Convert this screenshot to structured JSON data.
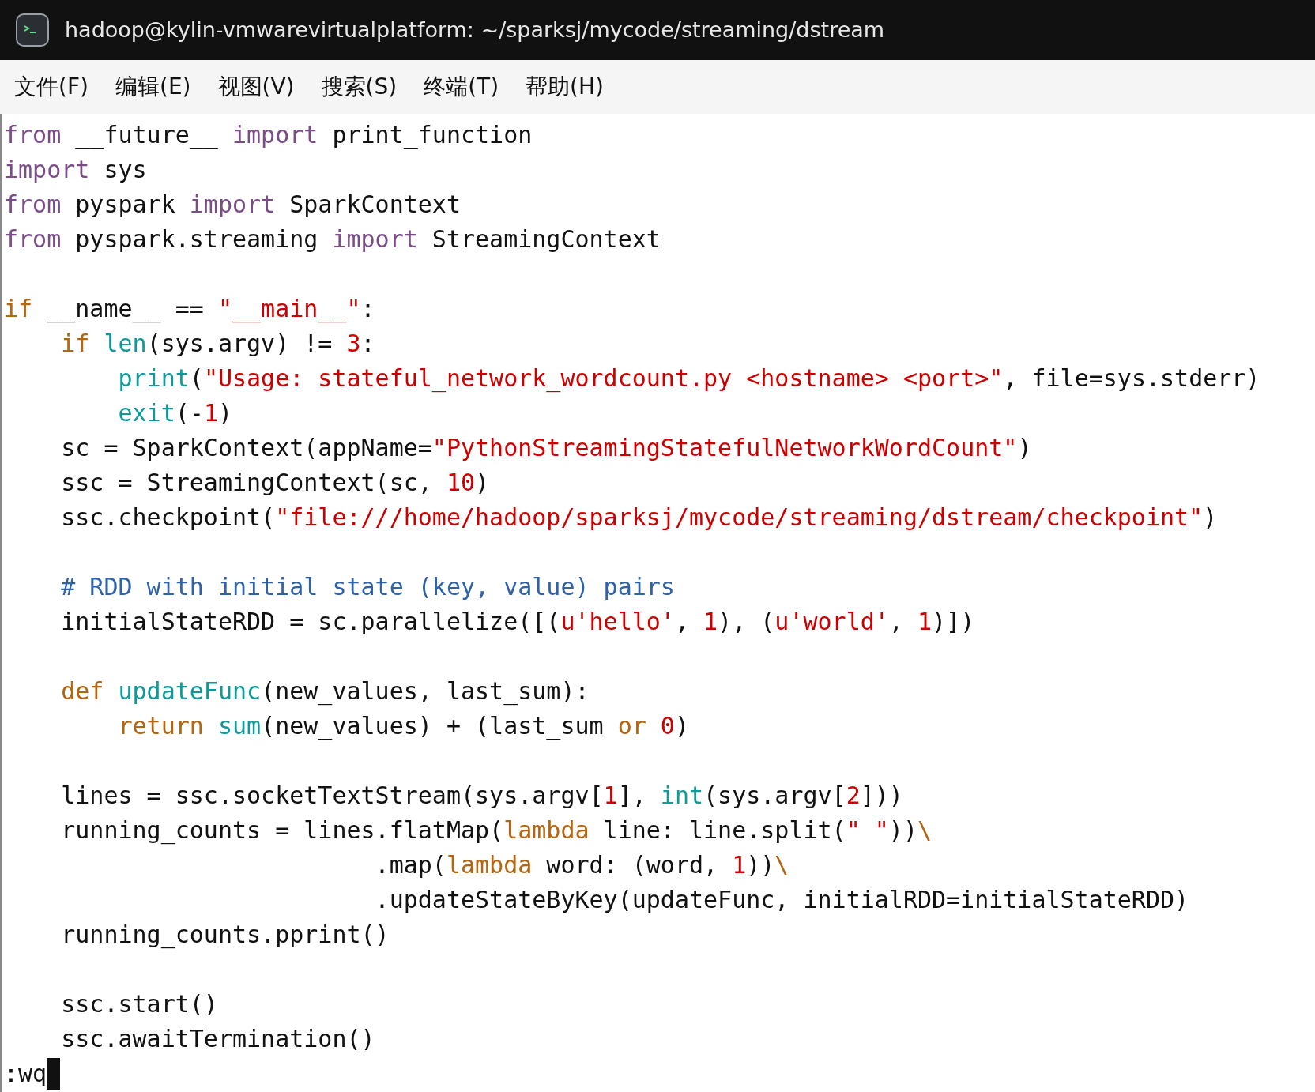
{
  "window": {
    "title": "hadoop@kylin-vmwarevirtualplatform: ~/sparksj/mycode/streaming/dstream"
  },
  "menu": [
    "文件(F)",
    "编辑(E)",
    "视图(V)",
    "搜索(S)",
    "终端(T)",
    "帮助(H)"
  ],
  "lines": [
    {
      "kind": "code",
      "tokens": [
        {
          "kind": "keyword",
          "text": "from"
        },
        {
          "kind": "plain",
          "text": " __future__ "
        },
        {
          "kind": "keyword",
          "text": "import"
        },
        {
          "kind": "plain",
          "text": " print_function"
        }
      ]
    },
    {
      "kind": "code",
      "tokens": [
        {
          "kind": "keyword",
          "text": "import"
        },
        {
          "kind": "plain",
          "text": " sys"
        }
      ]
    },
    {
      "kind": "code",
      "tokens": [
        {
          "kind": "keyword",
          "text": "from"
        },
        {
          "kind": "plain",
          "text": " pyspark "
        },
        {
          "kind": "keyword",
          "text": "import"
        },
        {
          "kind": "plain",
          "text": " SparkContext"
        }
      ]
    },
    {
      "kind": "code",
      "tokens": [
        {
          "kind": "keyword",
          "text": "from"
        },
        {
          "kind": "plain",
          "text": " pyspark.streaming "
        },
        {
          "kind": "keyword",
          "text": "import"
        },
        {
          "kind": "plain",
          "text": " StreamingContext"
        }
      ]
    },
    {
      "kind": "blank"
    },
    {
      "kind": "code",
      "tokens": [
        {
          "kind": "statement",
          "text": "if"
        },
        {
          "kind": "plain",
          "text": " __name__ == "
        },
        {
          "kind": "string",
          "text": "\"__main__\""
        },
        {
          "kind": "plain",
          "text": ":"
        }
      ]
    },
    {
      "kind": "code",
      "tokens": [
        {
          "kind": "statement",
          "text": "    if"
        },
        {
          "kind": "builtin",
          "text": " len"
        },
        {
          "kind": "plain",
          "text": "(sys.argv) != "
        },
        {
          "kind": "number",
          "text": "3"
        },
        {
          "kind": "plain",
          "text": ":"
        }
      ]
    },
    {
      "kind": "code",
      "tokens": [
        {
          "kind": "builtin",
          "text": "        print"
        },
        {
          "kind": "plain",
          "text": "("
        },
        {
          "kind": "string",
          "text": "\"Usage: stateful_network_wordcount.py <hostname> <port>\""
        },
        {
          "kind": "plain",
          "text": ", file=sys.stderr)"
        }
      ]
    },
    {
      "kind": "code",
      "tokens": [
        {
          "kind": "builtin",
          "text": "        exit"
        },
        {
          "kind": "plain",
          "text": "(-"
        },
        {
          "kind": "number",
          "text": "1"
        },
        {
          "kind": "plain",
          "text": ")"
        }
      ]
    },
    {
      "kind": "code",
      "tokens": [
        {
          "kind": "plain",
          "text": "    sc = SparkContext(appName="
        },
        {
          "kind": "string",
          "text": "\"PythonStreamingStatefulNetworkWordCount\""
        },
        {
          "kind": "plain",
          "text": ")"
        }
      ]
    },
    {
      "kind": "code",
      "tokens": [
        {
          "kind": "plain",
          "text": "    ssc = StreamingContext(sc, "
        },
        {
          "kind": "number",
          "text": "10"
        },
        {
          "kind": "plain",
          "text": ")"
        }
      ]
    },
    {
      "kind": "code",
      "tokens": [
        {
          "kind": "plain",
          "text": "    ssc.checkpoint("
        },
        {
          "kind": "string",
          "text": "\"file:///home/hadoop/sparksj/mycode/streaming/dstream/checkpoint\""
        },
        {
          "kind": "plain",
          "text": ")"
        }
      ]
    },
    {
      "kind": "blank"
    },
    {
      "kind": "code",
      "tokens": [
        {
          "kind": "comment",
          "text": "    # RDD with initial state (key, value) pairs"
        }
      ]
    },
    {
      "kind": "code",
      "tokens": [
        {
          "kind": "plain",
          "text": "    initialStateRDD = sc.parallelize([("
        },
        {
          "kind": "string",
          "text": "u'hello'"
        },
        {
          "kind": "plain",
          "text": ", "
        },
        {
          "kind": "number",
          "text": "1"
        },
        {
          "kind": "plain",
          "text": "), ("
        },
        {
          "kind": "string",
          "text": "u'world'"
        },
        {
          "kind": "plain",
          "text": ", "
        },
        {
          "kind": "number",
          "text": "1"
        },
        {
          "kind": "plain",
          "text": ")])"
        }
      ]
    },
    {
      "kind": "blank"
    },
    {
      "kind": "code",
      "tokens": [
        {
          "kind": "statement",
          "text": "    def"
        },
        {
          "kind": "builtin",
          "text": " updateFunc"
        },
        {
          "kind": "plain",
          "text": "(new_values, last_sum):"
        }
      ]
    },
    {
      "kind": "code",
      "tokens": [
        {
          "kind": "statement",
          "text": "        return"
        },
        {
          "kind": "builtin",
          "text": " sum"
        },
        {
          "kind": "plain",
          "text": "(new_values) + (last_sum "
        },
        {
          "kind": "statement",
          "text": "or"
        },
        {
          "kind": "number",
          "text": " 0"
        },
        {
          "kind": "plain",
          "text": ")"
        }
      ]
    },
    {
      "kind": "blank"
    },
    {
      "kind": "code",
      "tokens": [
        {
          "kind": "plain",
          "text": "    lines = ssc.socketTextStream(sys.argv["
        },
        {
          "kind": "number",
          "text": "1"
        },
        {
          "kind": "plain",
          "text": "], "
        },
        {
          "kind": "builtin",
          "text": "int"
        },
        {
          "kind": "plain",
          "text": "(sys.argv["
        },
        {
          "kind": "number",
          "text": "2"
        },
        {
          "kind": "plain",
          "text": "]))"
        }
      ]
    },
    {
      "kind": "code",
      "tokens": [
        {
          "kind": "plain",
          "text": "    running_counts = lines.flatMap("
        },
        {
          "kind": "statement",
          "text": "lambda"
        },
        {
          "kind": "plain",
          "text": " line: line.split("
        },
        {
          "kind": "string",
          "text": "\" \""
        },
        {
          "kind": "plain",
          "text": "))"
        },
        {
          "kind": "statement",
          "text": "\\"
        }
      ]
    },
    {
      "kind": "code",
      "tokens": [
        {
          "kind": "plain",
          "text": "                          .map("
        },
        {
          "kind": "statement",
          "text": "lambda"
        },
        {
          "kind": "plain",
          "text": " word: (word, "
        },
        {
          "kind": "number",
          "text": "1"
        },
        {
          "kind": "plain",
          "text": "))"
        },
        {
          "kind": "statement",
          "text": "\\"
        }
      ]
    },
    {
      "kind": "code",
      "tokens": [
        {
          "kind": "plain",
          "text": "                          .updateStateByKey(updateFunc, initialRDD=initialStateRDD)"
        }
      ]
    },
    {
      "kind": "code",
      "tokens": [
        {
          "kind": "plain",
          "text": "    running_counts.pprint()"
        }
      ]
    },
    {
      "kind": "blank"
    },
    {
      "kind": "code",
      "tokens": [
        {
          "kind": "plain",
          "text": "    ssc.start()"
        }
      ]
    },
    {
      "kind": "code",
      "tokens": [
        {
          "kind": "plain",
          "text": "    ssc.awaitTermination()"
        }
      ]
    }
  ],
  "command_line": {
    "text": ":wq",
    "cursor": true
  }
}
